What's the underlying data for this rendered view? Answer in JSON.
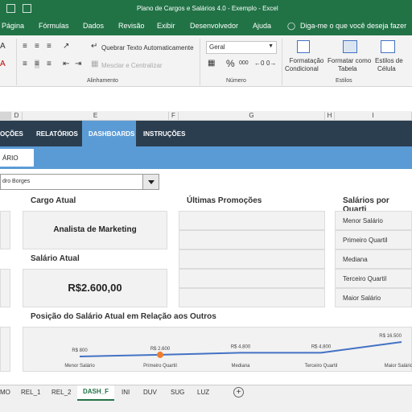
{
  "window": {
    "title": "Plano de Cargos e Salários 4.0 - Exemplo  -  Excel"
  },
  "menu": [
    "Página",
    "Fórmulas",
    "Dados",
    "Revisão",
    "Exibir",
    "Desenvolvedor",
    "Ajuda"
  ],
  "tell_me": "Diga-me o que você deseja fazer",
  "ribbon": {
    "wrap_text": "Quebrar Texto Automaticamente",
    "merge_center": "Mesclar e Centralizar",
    "alignment_group": "Alinhamento",
    "number_format": "Geral",
    "percent": "%",
    "thousands": "000",
    "number_group": "Número",
    "cond_format_1": "Formatação",
    "cond_format_2": "Condicional",
    "table_format_1": "Formatar como",
    "table_format_2": "Tabela",
    "cell_styles_1": "Estilos de",
    "cell_styles_2": "Célula",
    "styles_group": "Estilos"
  },
  "columns": [
    "D",
    "E",
    "F",
    "G",
    "H",
    "I"
  ],
  "nav": {
    "tab_1": "OÇÕES",
    "tab_2": "RELATÓRIOS",
    "tab_3": "DASHBOARDS",
    "tab_4": "INSTRUÇÕES",
    "sub_tab": "ÁRIO"
  },
  "employee_select": "dro Borges",
  "dashboard": {
    "cargo_heading": "Cargo Atual",
    "cargo_value": "Analista de Marketing",
    "salario_heading": "Salário Atual",
    "salario_value": "R$2.600,00",
    "promocoes_heading": "Últimas Promoções",
    "quartis_heading": "Salários por Quarti",
    "quartis": [
      "Menor Salário",
      "Primeiro Quartil",
      "Mediana",
      "Terceiro Quartil",
      "Maior Salário"
    ],
    "posicao_heading": "Posição do Salário Atual em Relação aos Outros"
  },
  "chart_data": {
    "type": "line",
    "categories": [
      "Menor Salário",
      "Primeiro Quartil",
      "Mediana",
      "Terceiro Quartil",
      "Maior Salário"
    ],
    "values": [
      800,
      2600,
      4800,
      4800,
      16500
    ],
    "labels": [
      "R$ 800",
      "R$ 2.600",
      "R$ 4.800",
      "R$ 4.800",
      "R$ 16.500"
    ],
    "highlight_index": 1,
    "line_color": "#4472c4",
    "highlight_color": "#ed7d31"
  },
  "sheet_tabs": [
    "MO",
    "REL_1",
    "REL_2",
    "DASH_F",
    "INI",
    "DUV",
    "SUG",
    "LUZ"
  ],
  "active_sheet": "DASH_F",
  "colors": {
    "excel_green": "#217346",
    "nav_dark": "#2b3e50",
    "nav_blue": "#5b9bd5"
  }
}
